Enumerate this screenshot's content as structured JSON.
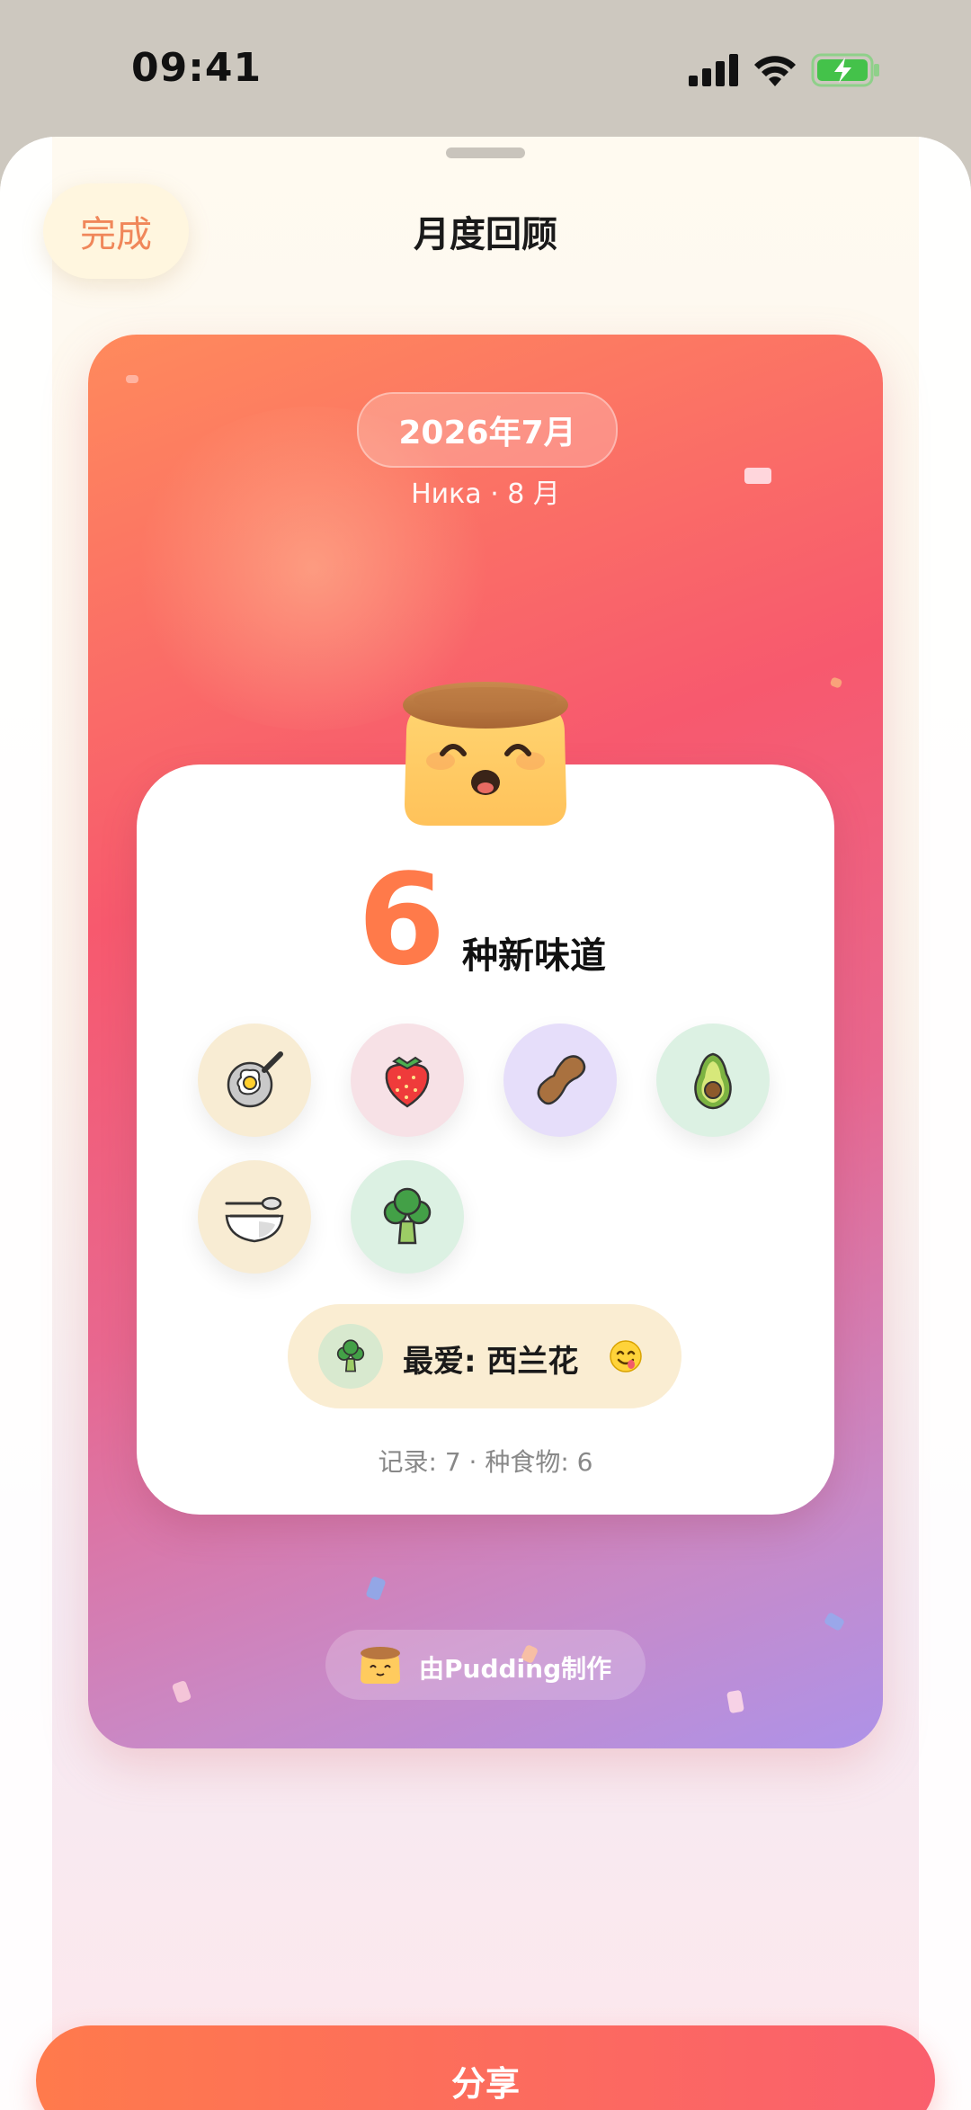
{
  "status_bar": {
    "time": "09:41"
  },
  "header": {
    "done_label": "完成",
    "title": "月度回顾"
  },
  "poster": {
    "date": "2026年7月",
    "subtitle": "Ника · 8 月",
    "new_tastes_count": "6",
    "new_tastes_label": "种新味道",
    "foods": [
      {
        "name": "fried-egg-icon",
        "bg": "#f8ecd3"
      },
      {
        "name": "strawberry-icon",
        "bg": "#f7e1e6"
      },
      {
        "name": "peanut-icon",
        "bg": "#e6defa"
      },
      {
        "name": "avocado-icon",
        "bg": "#dcf1e3"
      },
      {
        "name": "bowl-spoon-icon",
        "bg": "#f8ecd3"
      },
      {
        "name": "broccoli-icon",
        "bg": "#dcf1e3"
      }
    ],
    "favorite": "最爱: 西兰花",
    "stats": "记录: 7 · 种食物: 6",
    "made_by": "由Pudding制作"
  },
  "share_label": "分享",
  "colors": {
    "accent": "#ff7a4a",
    "gradient_start": "#ff7a4c",
    "gradient_end": "#fa5f6d"
  }
}
